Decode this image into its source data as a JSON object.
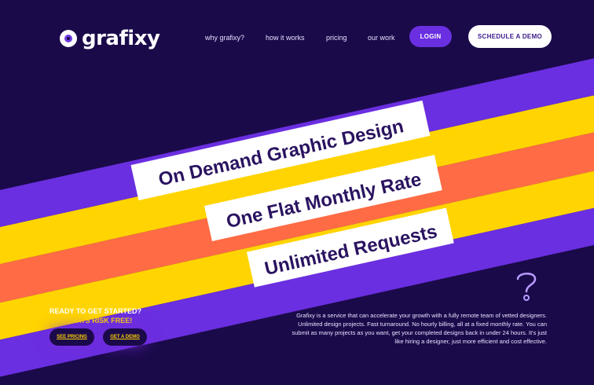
{
  "brand": {
    "name": "grafixy"
  },
  "nav": {
    "items": [
      "why grafixy?",
      "how it works",
      "pricing",
      "our work"
    ],
    "login_label": "LOGIN",
    "demo_label": "SCHEDULE A DEMO"
  },
  "hero": {
    "lines": [
      "On Demand Graphic Design",
      "One Flat Monthly Rate",
      "Unlimited Requests"
    ]
  },
  "cta": {
    "title": "READY TO GET STARTED?",
    "subtitle": "TRY 7 DAYS RISK FREE!",
    "pricing_label": "SEE PRICING",
    "demo_label": "GET A DEMO"
  },
  "description": "Grafixy is a service that can accelerate your growth with a fully remote team of vetted designers. Unlimited design projects. Fast turnaround. No hourly billing, all at a fixed monthly rate. You can submit as many projects as you want, get your completed designs back in under 24 hours. It's just like hiring a designer, just more efficient and cost effective.",
  "colors": {
    "background": "#1b0a4a",
    "purple": "#6a2fe0",
    "yellow": "#ffd400",
    "orange": "#ff6b45",
    "white": "#ffffff",
    "text_dark": "#2a1360"
  },
  "icons": {
    "help": "question-mark-icon"
  }
}
